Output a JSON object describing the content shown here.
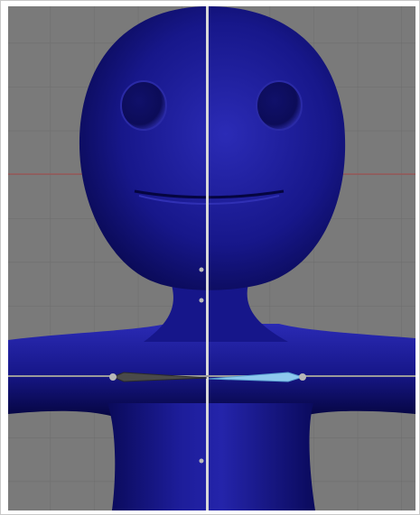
{
  "viewport": {
    "view": "front",
    "grid": true,
    "colors": {
      "background": "#7a7a7a",
      "grid_line": "#6a6a6a",
      "x_axis": "#a84b4b",
      "model": "#14147a",
      "model_highlight": "#2a2ab0",
      "model_shadow": "#05053a",
      "mirror_line": "#d8d8d8",
      "bone": "#3a3a3a",
      "bone_selected": "#8ec8ee",
      "joint": "#b8b8b8"
    },
    "mesh": {
      "name": "character-mesh"
    },
    "armature": {
      "bones": [
        {
          "name": "shoulder-bone-right",
          "selected": false
        },
        {
          "name": "shoulder-bone-left",
          "selected": true
        }
      ]
    }
  }
}
